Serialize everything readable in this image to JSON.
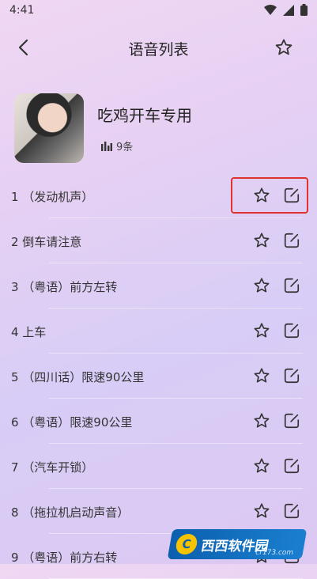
{
  "status": {
    "time": "4:41"
  },
  "header": {
    "title": "语音列表"
  },
  "playlist": {
    "title": "吃鸡开车专用",
    "count": "9条"
  },
  "items": [
    {
      "label": "1 （发动机声）"
    },
    {
      "label": "2 倒车请注意"
    },
    {
      "label": "3 （粤语）前方左转"
    },
    {
      "label": "4 上车"
    },
    {
      "label": "5 （四川话）限速90公里"
    },
    {
      "label": "6 （粤语）限速90公里"
    },
    {
      "label": "7 （汽车开锁）"
    },
    {
      "label": "8 （拖拉机启动声音）"
    },
    {
      "label": "9 （粤语）前方右转"
    }
  ],
  "watermark": {
    "logo": "C",
    "text": "西西软件园",
    "sub": "cr173.com"
  },
  "colors": {
    "highlight": "#e0322e",
    "icon": "#333333"
  }
}
